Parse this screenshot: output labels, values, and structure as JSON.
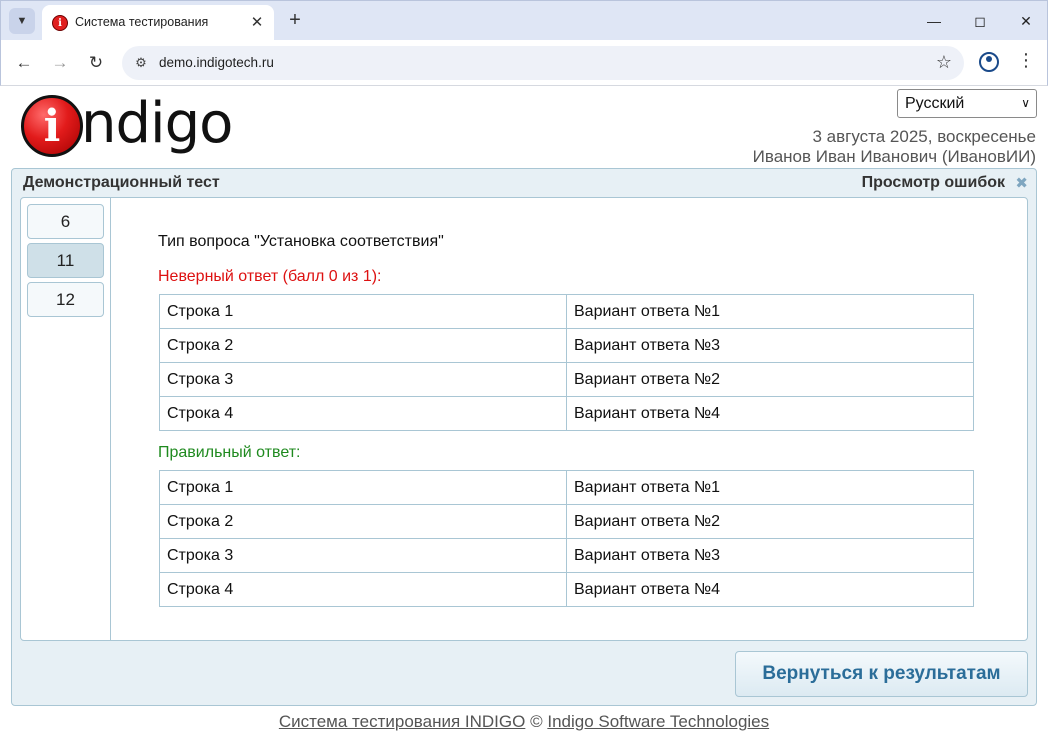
{
  "browser": {
    "tab_title": "Система тестирования",
    "url": "demo.indigotech.ru",
    "favicon": "i"
  },
  "header": {
    "logo_mark": "i",
    "logo_text": "ndigo",
    "language": "Русский",
    "date": "3 августа 2025, воскресенье",
    "user": "Иванов Иван Иванович (ИвановИИ)"
  },
  "panel": {
    "title": "Демонстрационный тест",
    "mode": "Просмотр ошибок"
  },
  "questions": [
    {
      "number": "6",
      "active": false
    },
    {
      "number": "11",
      "active": true
    },
    {
      "number": "12",
      "active": false
    }
  ],
  "question": {
    "type_label": "Тип вопроса \"Установка соответствия\"",
    "wrong_label": "Неверный ответ (балл 0 из 1):",
    "right_label": "Правильный ответ:",
    "wrong_rows": [
      [
        "Строка 1",
        "Вариант ответа №1"
      ],
      [
        "Строка 2",
        "Вариант ответа №3"
      ],
      [
        "Строка 3",
        "Вариант ответа №2"
      ],
      [
        "Строка 4",
        "Вариант ответа №4"
      ]
    ],
    "right_rows": [
      [
        "Строка 1",
        "Вариант ответа №1"
      ],
      [
        "Строка 2",
        "Вариант ответа №2"
      ],
      [
        "Строка 3",
        "Вариант ответа №3"
      ],
      [
        "Строка 4",
        "Вариант ответа №4"
      ]
    ]
  },
  "actions": {
    "back_label": "Вернуться к результатам"
  },
  "footer": {
    "system_link": "Система тестирования INDIGO",
    "copyright": "©",
    "company_link": "Indigo Software Technologies"
  },
  "colors": {
    "wrong": "#dd1111",
    "right": "#1f8a1f",
    "accent": "#2b6d99",
    "panel_bg": "#e7f0f5",
    "border": "#a9c6d4"
  }
}
